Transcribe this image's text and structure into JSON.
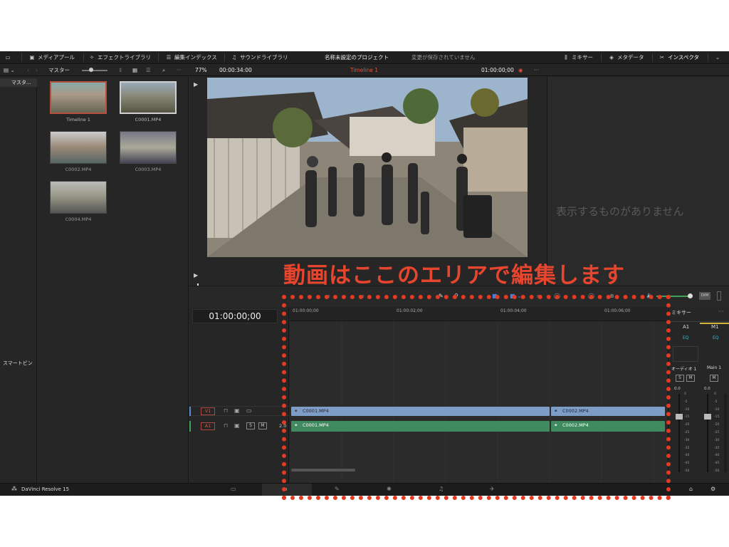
{
  "topbar": {
    "media_pool": "メディアプール",
    "effects_library": "エフェクトライブラリ",
    "edit_index": "編集インデックス",
    "sound_library": "サウンドライブラリ",
    "project_title": "名称未設定のプロジェクト",
    "save_status": "変更が保存されていません",
    "mixer": "ミキサー",
    "metadata": "メタデータ",
    "inspector": "インスペクタ"
  },
  "toolbar2": {
    "bin_title": "マスター",
    "zoom": "77%",
    "source_timecode": "00:00:34:00",
    "timeline_name": "Timeline 1",
    "record_timecode": "01:00:00;00"
  },
  "bins": {
    "master": "マスタ...",
    "smart_bins": "スマートビン"
  },
  "media": [
    {
      "label": "Timeline 1"
    },
    {
      "label": "C0001.MP4"
    },
    {
      "label": "C0002.MP4"
    },
    {
      "label": "C0003.MP4"
    },
    {
      "label": "C0004.MP4"
    }
  ],
  "inspector": {
    "empty_message": "表示するものがありません"
  },
  "timeline": {
    "timecode": "01:00:00;00",
    "ruler_ticks": [
      "01:00:00;00",
      "01:00:02;00",
      "01:00:04;00",
      "01:00:06;00"
    ],
    "tracks": [
      {
        "name": "V1",
        "clips": [
          "C0001.MP4",
          "C0002.MP4"
        ]
      },
      {
        "name": "A1",
        "channel": "2.0",
        "clips": [
          "C0001.MP4",
          "C0002.MP4"
        ]
      }
    ],
    "solo_label": "S",
    "mute_label": "M",
    "dim_label": "DIM"
  },
  "mixer": {
    "title": "ミキサー",
    "channels": [
      {
        "name": "A1",
        "eq": "EQ",
        "label": "オーディオ 1",
        "level": "0.0"
      },
      {
        "name": "M1",
        "eq": "EQ",
        "label": "Main 1",
        "level": "0.0"
      }
    ],
    "scale": [
      "0",
      "-5",
      "-10",
      "-15",
      "-20",
      "-25",
      "-30",
      "-35",
      "-40",
      "-45",
      "-50"
    ]
  },
  "status": {
    "app_name": "DaVinci Resolve 15"
  },
  "annotation": {
    "text": "動画はここのエリアで編集します",
    "color": "#e8452e"
  }
}
